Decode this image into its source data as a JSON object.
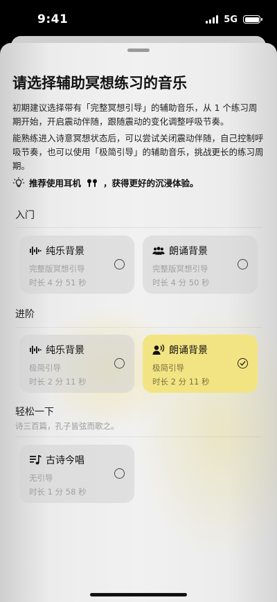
{
  "status_bar": {
    "time": "9:41",
    "network": "5G"
  },
  "sheet": {
    "title": "请选择辅助冥想练习的音乐",
    "paragraph1": "初期建议选择带有「完整冥想引导」的辅助音乐，从 1 个练习周期开始，开启震动伴随，跟随震动的变化调整呼吸节奏。",
    "paragraph2": "能熟练进入诗意冥想状态后，可以尝试关闭震动伴随，自己控制呼吸节奏，也可以使用「极简引导」的辅助音乐，挑战更长的练习周期。",
    "tip": {
      "before": "推荐使用耳机",
      "after": "，获得更好的沉浸体验。",
      "icon": "lightbulb-icon"
    }
  },
  "sections": [
    {
      "label": "入门",
      "cards": [
        {
          "title": "纯乐背景",
          "icon": "waveform-icon",
          "line1": "完整版冥想引导",
          "line2": "时长 4 分 51 秒",
          "selected": false
        },
        {
          "title": "朗诵背景",
          "icon": "people-icon",
          "line1": "完整版冥想引导",
          "line2": "时长 4 分 50 秒",
          "selected": false
        }
      ]
    },
    {
      "label": "进阶",
      "cards": [
        {
          "title": "纯乐背景",
          "icon": "waveform-icon",
          "line1": "极简引导",
          "line2": "时长 2 分 11 秒",
          "selected": false
        },
        {
          "title": "朗诵背景",
          "icon": "speaker-person-icon",
          "line1": "极简引导",
          "line2": "时长 2 分 11 秒",
          "selected": true
        }
      ]
    },
    {
      "label": "轻松一下",
      "subtitle": "诗三百篇，孔子皆弦而歌之。",
      "cards": [
        {
          "title": "古诗今唱",
          "icon": "music-list-icon",
          "line1": "无引导",
          "line2": "时长 1 分 58 秒",
          "selected": false
        }
      ]
    }
  ],
  "colors": {
    "selected_card": "#f3e483",
    "card": "#d2d2d2"
  }
}
